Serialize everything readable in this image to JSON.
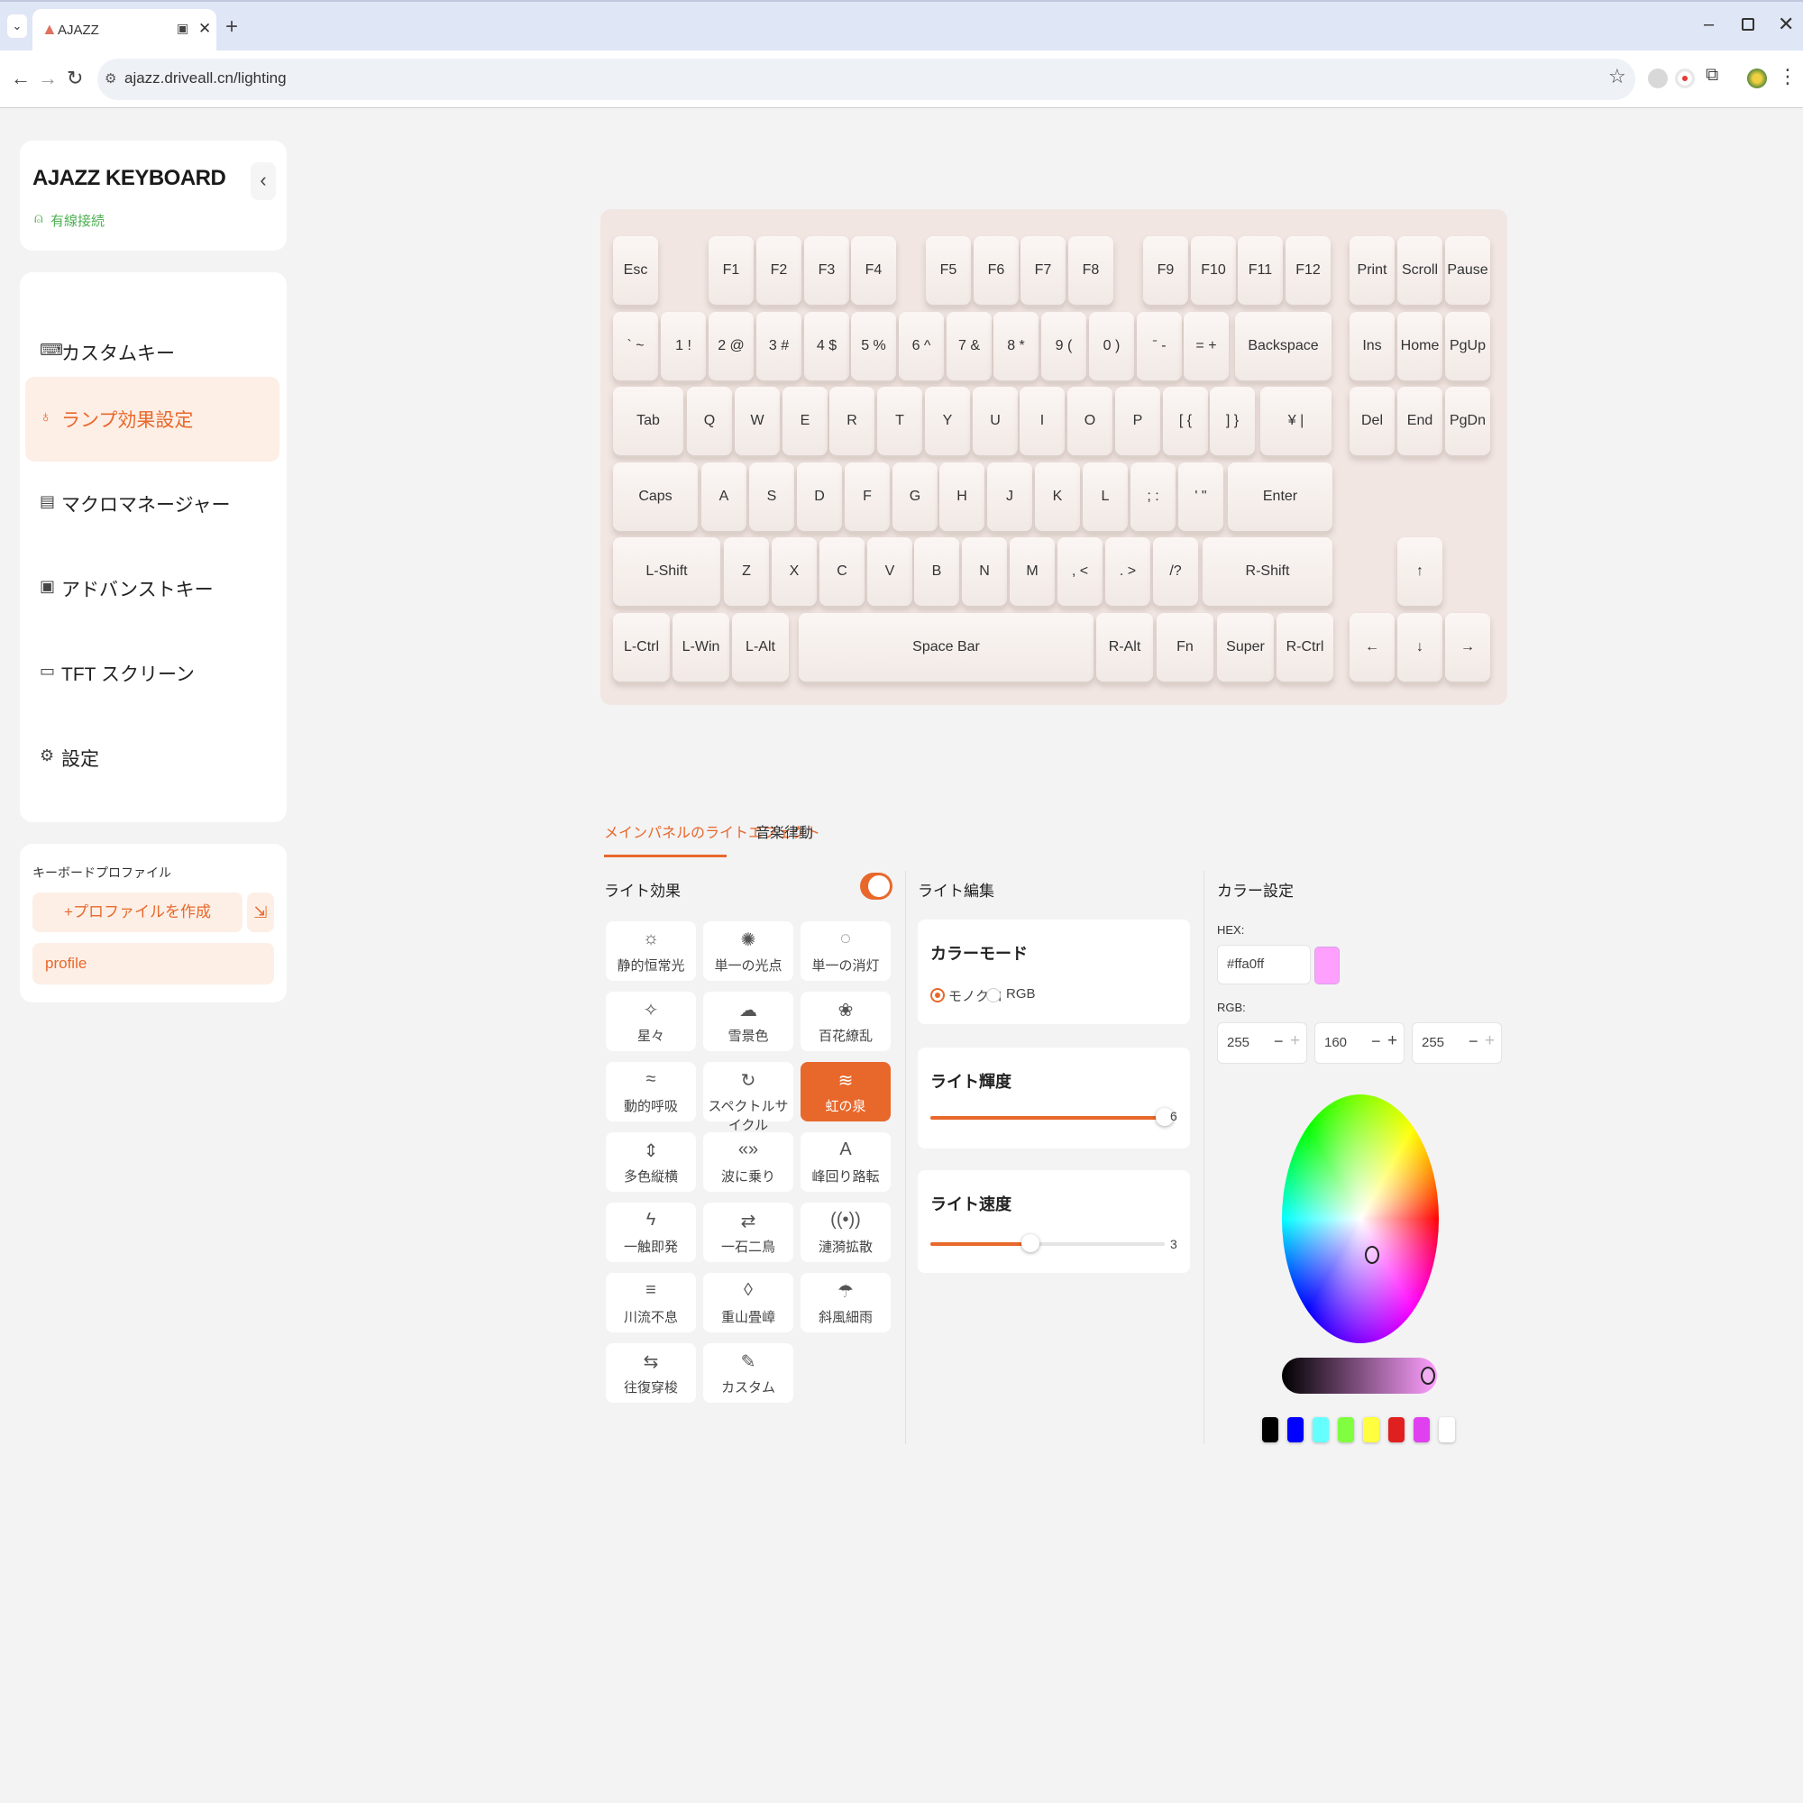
{
  "browser": {
    "tab_title": "AJAZZ",
    "url": "ajazz.driveall.cn/lighting"
  },
  "sidebar": {
    "brand": "AJAZZ KEYBOARD",
    "connection_icon": "usb-icon",
    "connection": "有線接続",
    "menu": [
      {
        "label": "カスタムキー",
        "icon": "custom-key-icon",
        "active": false
      },
      {
        "label": "ランプ効果設定",
        "icon": "bulb-icon",
        "active": true
      },
      {
        "label": "マクロマネージャー",
        "icon": "macro-icon",
        "active": false
      },
      {
        "label": "アドバンストキー",
        "icon": "advanced-key-icon",
        "active": false
      },
      {
        "label": "TFT スクリーン",
        "icon": "monitor-icon",
        "active": false
      },
      {
        "label": "設定",
        "icon": "gear-icon",
        "active": false
      }
    ],
    "profiles": {
      "title": "キーボードプロファイル",
      "create": "+プロファイルを作成",
      "items": [
        "profile"
      ]
    }
  },
  "keyboard": {
    "rows": [
      [
        "Esc",
        "F1",
        "F2",
        "F3",
        "F4",
        "F5",
        "F6",
        "F7",
        "F8",
        "F9",
        "F10",
        "F11",
        "F12",
        "Print",
        "Scroll",
        "Pause"
      ],
      [
        "` ~",
        "1 !",
        "2 @",
        "3 #",
        "4 $",
        "5 %",
        "6 ^",
        "7 &",
        "8 *",
        "9 (",
        "0 )",
        "ˉ -",
        "= +",
        "Backspace",
        "Ins",
        "Home",
        "PgUp"
      ],
      [
        "Tab",
        "Q",
        "W",
        "E",
        "R",
        "T",
        "Y",
        "U",
        "I",
        "O",
        "P",
        "[ {",
        "] }",
        "¥ |",
        "Del",
        "End",
        "PgDn"
      ],
      [
        "Caps",
        "A",
        "S",
        "D",
        "F",
        "G",
        "H",
        "J",
        "K",
        "L",
        "; :",
        "' \"",
        "Enter"
      ],
      [
        "L-Shift",
        "Z",
        "X",
        "C",
        "V",
        "B",
        "N",
        "M",
        ", <",
        ". >",
        "/?",
        "R-Shift",
        "↑"
      ],
      [
        "L-Ctrl",
        "L-Win",
        "L-Alt",
        "Space Bar",
        "R-Alt",
        "Fn",
        "Super",
        "R-Ctrl",
        "←",
        "↓",
        "→"
      ]
    ]
  },
  "tabs": {
    "main": "メインパネルのライトエフェクト",
    "music": "音楽律動"
  },
  "effects": {
    "title": "ライト効果",
    "enabled": true,
    "items": [
      {
        "label": "静的恒常光",
        "icon": "sun-icon",
        "glyph": "☼"
      },
      {
        "label": "単一の光点",
        "icon": "bulb-on-icon",
        "glyph": "✺"
      },
      {
        "label": "単一の消灯",
        "icon": "bulb-off-icon",
        "glyph": "◌"
      },
      {
        "label": "星々",
        "icon": "sparkle-icon",
        "glyph": "✧"
      },
      {
        "label": "雪景色",
        "icon": "snow-cloud-icon",
        "glyph": "☁"
      },
      {
        "label": "百花繚乱",
        "icon": "flower-icon",
        "glyph": "❀"
      },
      {
        "label": "動的呼吸",
        "icon": "wind-icon",
        "glyph": "≈"
      },
      {
        "label": "スペクトルサイクル",
        "icon": "cycle-icon",
        "glyph": "↻"
      },
      {
        "label": "虹の泉",
        "icon": "rainbow-icon",
        "glyph": "≋",
        "active": true
      },
      {
        "label": "多色縦横",
        "icon": "up-down-icon",
        "glyph": "⇕"
      },
      {
        "label": "波に乗り",
        "icon": "wave-icon",
        "glyph": "«»"
      },
      {
        "label": "峰回り路転",
        "icon": "road-icon",
        "glyph": "A"
      },
      {
        "label": "一触即発",
        "icon": "lightning-icon",
        "glyph": "ϟ"
      },
      {
        "label": "一石二鳥",
        "icon": "arrows-icon",
        "glyph": "⇄"
      },
      {
        "label": "漣漪拡散",
        "icon": "ripple-icon",
        "glyph": "((•))"
      },
      {
        "label": "川流不息",
        "icon": "stream-icon",
        "glyph": "≡"
      },
      {
        "label": "重山畳嶂",
        "icon": "mountain-icon",
        "glyph": "◊"
      },
      {
        "label": "斜風細雨",
        "icon": "rain-icon",
        "glyph": "☂"
      },
      {
        "label": "往復穿梭",
        "icon": "shuttle-icon",
        "glyph": "⇆"
      },
      {
        "label": "カスタム",
        "icon": "edit-icon",
        "glyph": "✎"
      }
    ]
  },
  "edit": {
    "title": "ライト編集",
    "color_mode": {
      "title": "カラーモード",
      "options": [
        "モノクロ",
        "RGB"
      ],
      "selected": "モノクロ"
    },
    "brightness": {
      "title": "ライト輝度",
      "value": 6,
      "max": 6
    },
    "speed": {
      "title": "ライト速度",
      "value": 3,
      "max": 7
    }
  },
  "color": {
    "title": "カラー設定",
    "hex_label": "HEX:",
    "hex": "#ffa0ff",
    "rgb_label": "RGB:",
    "rgb": [
      255,
      160,
      255
    ],
    "presets": [
      "#000000",
      "#0000ff",
      "#66ffff",
      "#80ff40",
      "#ffff40",
      "#e02020",
      "#e040f0",
      "#ffffff"
    ]
  },
  "colors": {
    "accent": "#e8682b",
    "accent_light": "#fdefe6",
    "connected": "#4caf50"
  }
}
